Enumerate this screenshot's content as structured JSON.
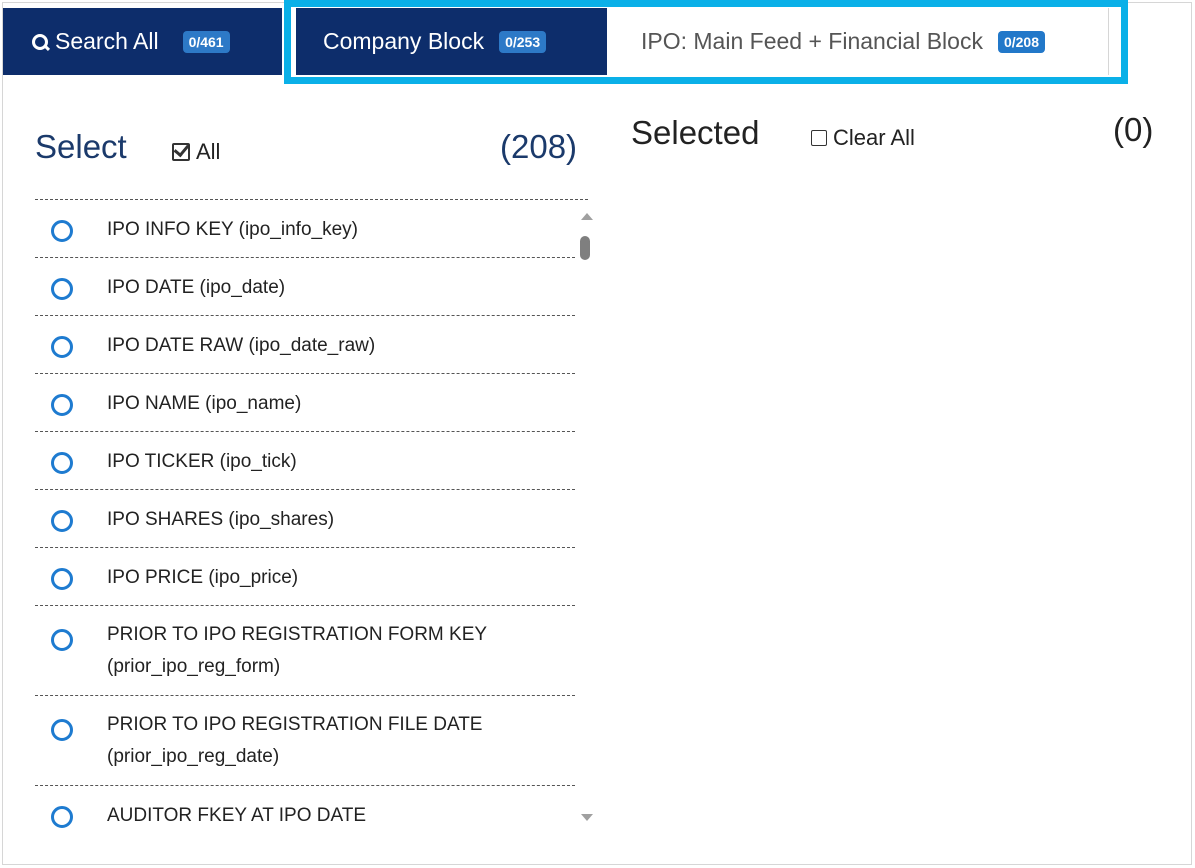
{
  "tabs": {
    "search": {
      "label": "Search All",
      "badge": "0/461"
    },
    "company": {
      "label": "Company Block",
      "badge": "0/253"
    },
    "ipo": {
      "label": "IPO: Main Feed + Financial Block",
      "badge": "0/208"
    }
  },
  "select_panel": {
    "title": "Select",
    "all_label": "All",
    "count": "(208)",
    "items": [
      {
        "line1": "IPO INFO KEY (ipo_info_key)",
        "line2": ""
      },
      {
        "line1": "IPO DATE (ipo_date)",
        "line2": ""
      },
      {
        "line1": "IPO DATE RAW (ipo_date_raw)",
        "line2": ""
      },
      {
        "line1": "IPO NAME (ipo_name)",
        "line2": ""
      },
      {
        "line1": "IPO TICKER (ipo_tick)",
        "line2": ""
      },
      {
        "line1": "IPO SHARES (ipo_shares)",
        "line2": ""
      },
      {
        "line1": "IPO PRICE (ipo_price)",
        "line2": ""
      },
      {
        "line1": "PRIOR TO IPO REGISTRATION FORM KEY",
        "line2": "(prior_ipo_reg_form)"
      },
      {
        "line1": "PRIOR TO IPO REGISTRATION FILE DATE",
        "line2": "(prior_ipo_reg_date)"
      },
      {
        "line1": "AUDITOR FKEY AT IPO DATE",
        "line2": ""
      }
    ]
  },
  "selected_panel": {
    "title": "Selected",
    "clear_all_label": "Clear All",
    "count": "(0)"
  },
  "colors": {
    "tab_active_bg": "#0d2d6b",
    "badge_bg": "#2d79c7",
    "highlight": "#0ab0e8",
    "radio": "#1e7bd0",
    "heading": "#1b3a6b"
  }
}
